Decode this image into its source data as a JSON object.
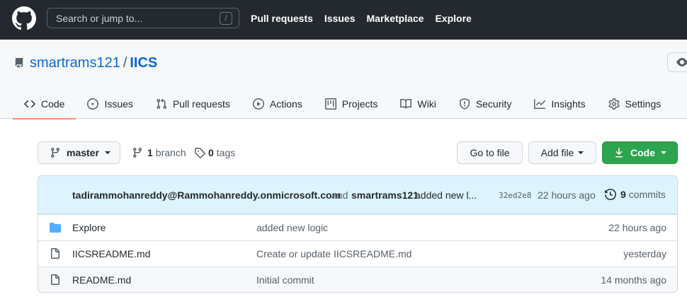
{
  "header": {
    "search_placeholder": "Search or jump to...",
    "search_shortcut": "/",
    "nav": [
      "Pull requests",
      "Issues",
      "Marketplace",
      "Explore"
    ]
  },
  "repo": {
    "owner": "smartrams121",
    "separator": "/",
    "name": "IICS",
    "tabs": [
      {
        "label": "Code",
        "icon": "code-icon",
        "active": true
      },
      {
        "label": "Issues",
        "icon": "issue-icon"
      },
      {
        "label": "Pull requests",
        "icon": "pull-request-icon"
      },
      {
        "label": "Actions",
        "icon": "play-icon"
      },
      {
        "label": "Projects",
        "icon": "project-icon"
      },
      {
        "label": "Wiki",
        "icon": "book-icon"
      },
      {
        "label": "Security",
        "icon": "shield-icon"
      },
      {
        "label": "Insights",
        "icon": "graph-icon"
      },
      {
        "label": "Settings",
        "icon": "gear-icon"
      }
    ]
  },
  "toolbar": {
    "branch": "master",
    "branch_count": "1",
    "branch_label": "branch",
    "tag_count": "0",
    "tag_label": "tags",
    "goto_label": "Go to file",
    "addfile_label": "Add file",
    "code_label": "Code"
  },
  "commit": {
    "author": "tadirammohanreddy@Rammohanreddy.onmicrosoft.com",
    "and": "and",
    "coauthor": "smartrams121",
    "message": "added new l...",
    "sha": "32ed2e8",
    "time": "22 hours ago",
    "commit_count": "9",
    "commit_label": "commits"
  },
  "files": [
    {
      "name": "Explore",
      "type": "folder",
      "message": "added new logic",
      "age": "22 hours ago"
    },
    {
      "name": "IICSREADME.md",
      "type": "file",
      "message": "Create or update IICSREADME.md",
      "age": "yesterday"
    },
    {
      "name": "README.md",
      "type": "file",
      "message": "Initial commit",
      "age": "14 months ago"
    }
  ],
  "colors": {
    "header_bg": "#24292f",
    "link": "#0969da",
    "primary_button": "#2da44e",
    "active_tab_underline": "#fd8c73",
    "commit_bar_bg": "#ddf4ff",
    "folder": "#54aeff"
  }
}
